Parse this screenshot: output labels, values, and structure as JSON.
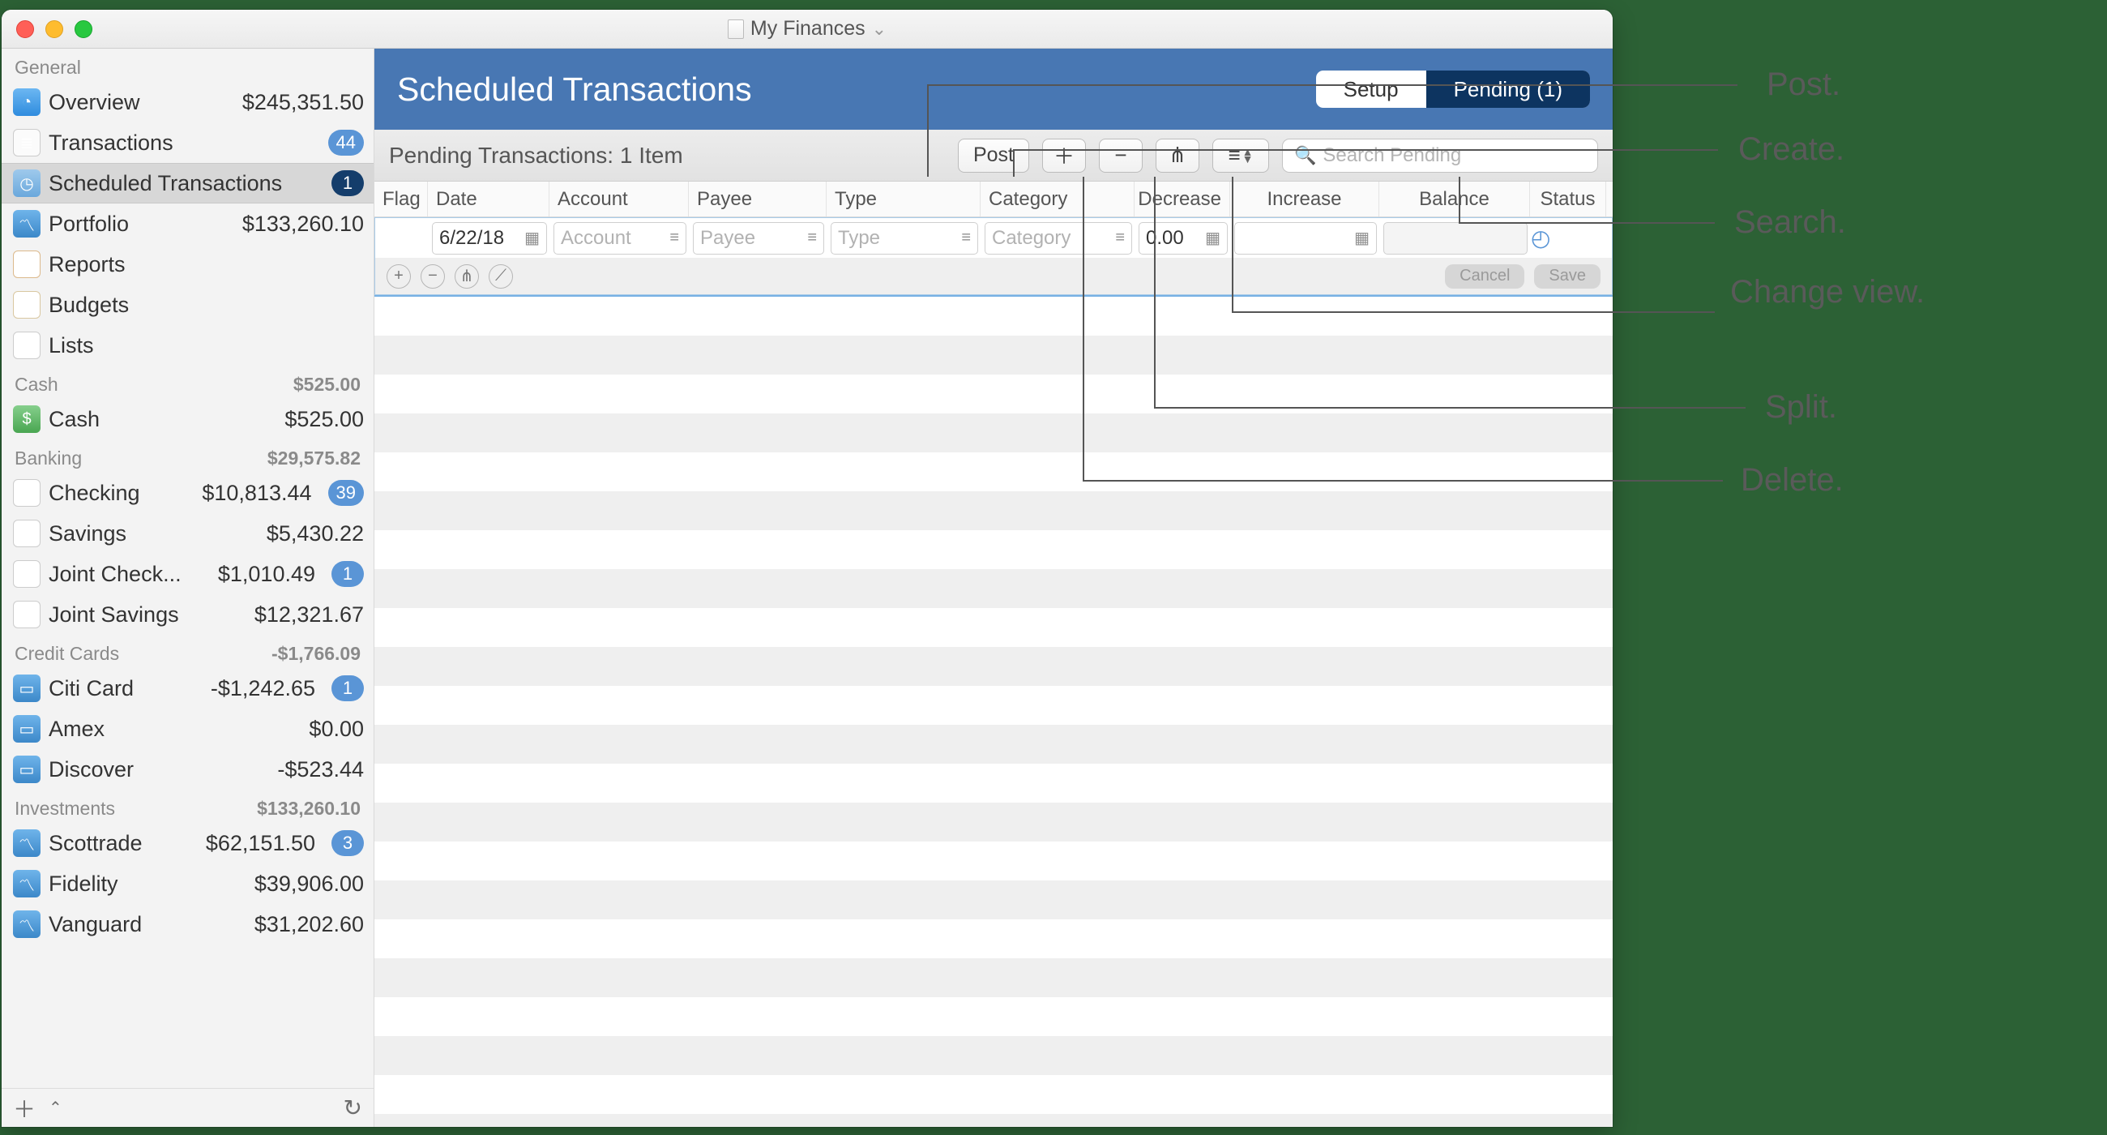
{
  "window": {
    "title": "My Finances"
  },
  "sidebar": {
    "groups": [
      {
        "label": "General",
        "value": "",
        "items": [
          {
            "icon": "overview",
            "label": "Overview",
            "value": "$245,351.50"
          },
          {
            "icon": "trans",
            "label": "Transactions",
            "badge": "44"
          },
          {
            "icon": "sched",
            "label": "Scheduled Transactions",
            "badge": "1",
            "selected": true
          },
          {
            "icon": "port",
            "label": "Portfolio",
            "value": "$133,260.10"
          },
          {
            "icon": "report",
            "label": "Reports"
          },
          {
            "icon": "budget",
            "label": "Budgets"
          },
          {
            "icon": "list",
            "label": "Lists"
          }
        ]
      },
      {
        "label": "Cash",
        "value": "$525.00",
        "items": [
          {
            "icon": "cash",
            "label": "Cash",
            "value": "$525.00"
          }
        ]
      },
      {
        "label": "Banking",
        "value": "$29,575.82",
        "items": [
          {
            "icon": "bank",
            "label": "Checking",
            "value": "$10,813.44",
            "badge": "39"
          },
          {
            "icon": "bank",
            "label": "Savings",
            "value": "$5,430.22"
          },
          {
            "icon": "bank",
            "label": "Joint Check...",
            "value": "$1,010.49",
            "badge": "1"
          },
          {
            "icon": "bank",
            "label": "Joint Savings",
            "value": "$12,321.67"
          }
        ]
      },
      {
        "label": "Credit Cards",
        "value": "-$1,766.09",
        "items": [
          {
            "icon": "card",
            "label": "Citi Card",
            "value": "-$1,242.65",
            "badge": "1"
          },
          {
            "icon": "card",
            "label": "Amex",
            "value": "$0.00"
          },
          {
            "icon": "card",
            "label": "Discover",
            "value": "-$523.44"
          }
        ]
      },
      {
        "label": "Investments",
        "value": "$133,260.10",
        "items": [
          {
            "icon": "port",
            "label": "Scottrade",
            "value": "$62,151.50",
            "badge": "3"
          },
          {
            "icon": "port",
            "label": "Fidelity",
            "value": "$39,906.00"
          },
          {
            "icon": "port",
            "label": "Vanguard",
            "value": "$31,202.60"
          }
        ]
      }
    ]
  },
  "header": {
    "title": "Scheduled Transactions",
    "seg": {
      "setup": "Setup",
      "pending": "Pending (1)"
    }
  },
  "toolbar": {
    "subtitle": "Pending Transactions: 1 Item",
    "post": "Post",
    "search_placeholder": "Search Pending"
  },
  "columns": {
    "flag": "Flag",
    "date": "Date",
    "account": "Account",
    "payee": "Payee",
    "type": "Type",
    "category": "Category",
    "decrease": "Decrease",
    "increase": "Increase",
    "balance": "Balance",
    "status": "Status"
  },
  "row": {
    "date": "6/22/18",
    "account_ph": "Account",
    "payee_ph": "Payee",
    "type_ph": "Type",
    "category_ph": "Category",
    "decrease": "0.00",
    "cancel": "Cancel",
    "save": "Save"
  },
  "annotations": {
    "post": "Post.",
    "create": "Create.",
    "search": "Search.",
    "view": "Change view.",
    "split": "Split.",
    "delete": "Delete."
  }
}
